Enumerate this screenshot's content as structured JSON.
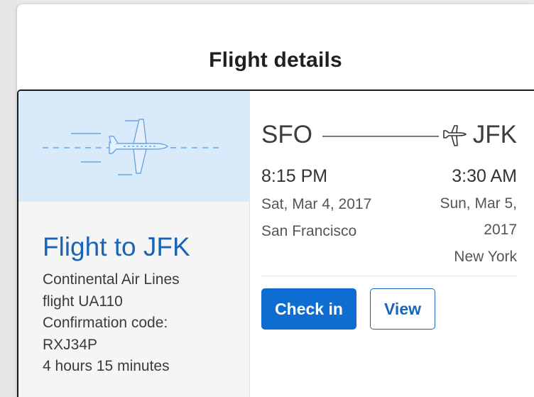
{
  "dialog": {
    "title": "Flight details"
  },
  "card": {
    "title": "Flight to JFK",
    "airline": "Continental Air Lines",
    "flight": "flight UA110",
    "confirmation_label": "Confirmation code:",
    "confirmation_code": "RXJ34P",
    "duration": "4 hours 15 minutes",
    "hero_icon": "airplane-icon"
  },
  "route": {
    "from": "SFO",
    "to": "JFK",
    "plane_icon": "airplane-icon"
  },
  "departure": {
    "time": "8:15 PM",
    "date": "Sat, Mar 4, 2017",
    "city": "San Francisco"
  },
  "arrival": {
    "time": "3:30 AM",
    "date": "Sun, Mar 5, 2017",
    "city": "New York"
  },
  "actions": {
    "check_in": "Check in",
    "view": "View"
  },
  "colors": {
    "accent": "#0f6cd1",
    "title_link": "#1a64b8",
    "hero_bg": "#d9eafb"
  }
}
